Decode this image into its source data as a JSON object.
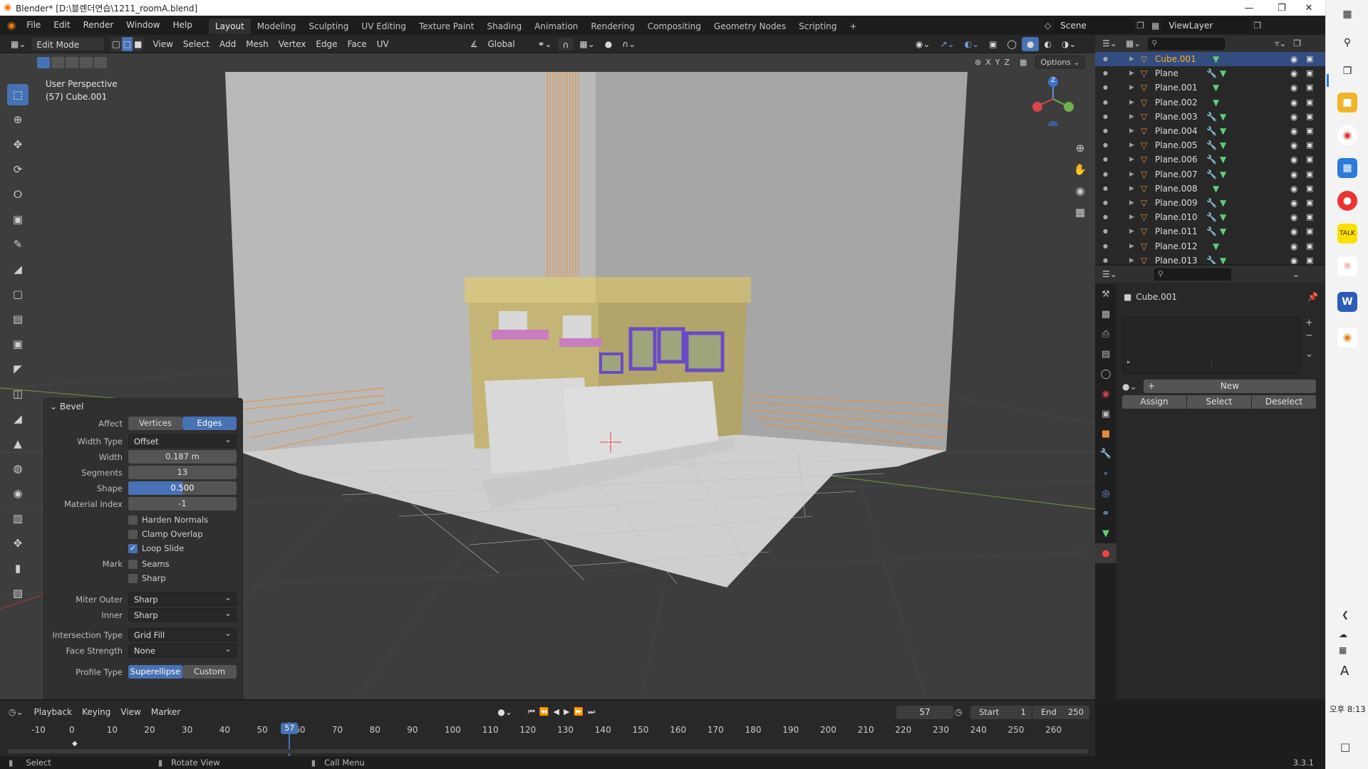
{
  "window": {
    "title": "Blender* [D:\\블렌더연습\\1211_roomA.blend]",
    "minimize": "—",
    "restore": "❐",
    "close": "✕"
  },
  "menus": [
    "File",
    "Edit",
    "Render",
    "Window",
    "Help"
  ],
  "workspaces": [
    "Layout",
    "Modeling",
    "Sculpting",
    "UV Editing",
    "Texture Paint",
    "Shading",
    "Animation",
    "Rendering",
    "Compositing",
    "Geometry Nodes",
    "Scripting",
    "+"
  ],
  "scene": {
    "label": "Scene",
    "viewlayer": "ViewLayer"
  },
  "vp_header": {
    "mode": "Edit Mode",
    "menus": [
      "View",
      "Select",
      "Add",
      "Mesh",
      "Vertex",
      "Edge",
      "Face",
      "UV"
    ],
    "orientation": "Global",
    "options": "Options",
    "axes": [
      "X",
      "Y",
      "Z"
    ]
  },
  "viewport": {
    "perspective": "User Perspective",
    "object": "(57) Cube.001"
  },
  "gizmo": {
    "z": "Z"
  },
  "bevel": {
    "title": "Bevel",
    "affect_label": "Affect",
    "affect_options": [
      "Vertices",
      "Edges"
    ],
    "affect_selected": "Edges",
    "width_type_label": "Width Type",
    "width_type": "Offset",
    "width_label": "Width",
    "width": "0.187 m",
    "segments_label": "Segments",
    "segments": "13",
    "shape_label": "Shape",
    "shape": "0.500",
    "shape_fraction": 0.5,
    "material_label": "Material Index",
    "material": "-1",
    "harden": "Harden Normals",
    "clamp": "Clamp Overlap",
    "loop_slide": "Loop Slide",
    "mark_label": "Mark",
    "seams": "Seams",
    "sharp": "Sharp",
    "miter_outer_label": "Miter Outer",
    "miter_outer": "Sharp",
    "inner_label": "Inner",
    "inner": "Sharp",
    "intersection_label": "Intersection Type",
    "intersection": "Grid Fill",
    "face_strength_label": "Face Strength",
    "face_strength": "None",
    "profile_label": "Profile Type",
    "profile_options": [
      "Superellipse",
      "Custom"
    ],
    "profile_selected": "Superellipse"
  },
  "outliner": {
    "items": [
      {
        "name": "Cube.001",
        "selected": true,
        "modifier": false
      },
      {
        "name": "Plane",
        "selected": false,
        "modifier": true
      },
      {
        "name": "Plane.001",
        "selected": false,
        "modifier": false
      },
      {
        "name": "Plane.002",
        "selected": false,
        "modifier": false
      },
      {
        "name": "Plane.003",
        "selected": false,
        "modifier": true
      },
      {
        "name": "Plane.004",
        "selected": false,
        "modifier": true
      },
      {
        "name": "Plane.005",
        "selected": false,
        "modifier": true
      },
      {
        "name": "Plane.006",
        "selected": false,
        "modifier": true
      },
      {
        "name": "Plane.007",
        "selected": false,
        "modifier": true
      },
      {
        "name": "Plane.008",
        "selected": false,
        "modifier": false
      },
      {
        "name": "Plane.009",
        "selected": false,
        "modifier": true
      },
      {
        "name": "Plane.010",
        "selected": false,
        "modifier": true
      },
      {
        "name": "Plane.011",
        "selected": false,
        "modifier": true
      },
      {
        "name": "Plane.012",
        "selected": false,
        "modifier": false
      },
      {
        "name": "Plane.013",
        "selected": false,
        "modifier": true
      }
    ]
  },
  "properties": {
    "object": "Cube.001",
    "new": "New",
    "assign": "Assign",
    "select": "Select",
    "deselect": "Deselect"
  },
  "timeline": {
    "menus": [
      "Playback",
      "Keying",
      "View",
      "Marker"
    ],
    "current": "57",
    "start_label": "Start",
    "start": "1",
    "end_label": "End",
    "end": "250",
    "ticks": [
      "-10",
      "0",
      "10",
      "20",
      "30",
      "40",
      "50",
      "60",
      "70",
      "80",
      "90",
      "100",
      "110",
      "120",
      "130",
      "140",
      "150",
      "160",
      "170",
      "180",
      "190",
      "200",
      "210",
      "220",
      "230",
      "240",
      "250",
      "260"
    ]
  },
  "status": {
    "select": "Select",
    "rotate": "Rotate View",
    "call_menu": "Call Menu",
    "version": "3.3.1"
  },
  "taskbar": {
    "clock": "오후 8:13",
    "font_glyph": "A"
  }
}
